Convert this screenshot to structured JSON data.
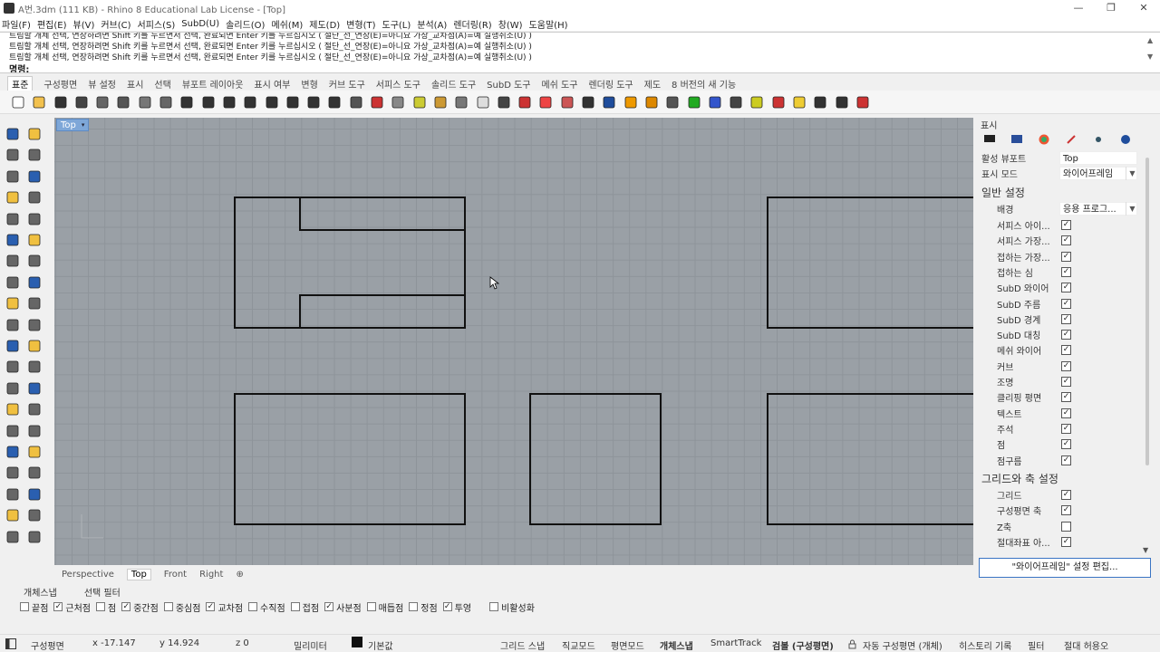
{
  "window": {
    "title": "A번.3dm (111 KB) - Rhino 8 Educational Lab License - [Top]",
    "min": "—",
    "max": "❐",
    "close": "✕"
  },
  "menu": [
    "파일(F)",
    "편집(E)",
    "뷰(V)",
    "커브(C)",
    "서피스(S)",
    "SubD(U)",
    "솔리드(O)",
    "메쉬(M)",
    "제도(D)",
    "변형(T)",
    "도구(L)",
    "분석(A)",
    "렌더링(R)",
    "창(W)",
    "도움말(H)"
  ],
  "command": {
    "lines": [
      "트림할 개체 선택, 연장하려면 Shift 키를 누르면서 선택, 완료되면 Enter 키를 누르십시오 ( 절단_선_연장(E)=아니요  가상_교차점(A)=예  실행취소(U) )",
      "트림할 개체 선택, 연장하려면 Shift 키를 누르면서 선택, 완료되면 Enter 키를 누르십시오 ( 절단_선_연장(E)=아니요  가상_교차점(A)=예  실행취소(U) )",
      "트림할 개체 선택, 연장하려면 Shift 키를 누르면서 선택, 완료되면 Enter 키를 누르십시오 ( 절단_선_연장(E)=아니요  가상_교차점(A)=예  실행취소(U) )"
    ],
    "prompt": "명령:"
  },
  "toolbar_tabs": [
    "표준",
    "구성평면",
    "뷰 설정",
    "표시",
    "선택",
    "뷰포트 레이아웃",
    "표시 여부",
    "변형",
    "커브 도구",
    "서피스 도구",
    "솔리드 도구",
    "SubD 도구",
    "메쉬 도구",
    "렌더링 도구",
    "제도",
    "8 버전의 새 기능"
  ],
  "toolbar_icons": [
    "new",
    "open",
    "save",
    "print",
    "props",
    "cut",
    "copy",
    "paste",
    "undo",
    "pan",
    "rotate",
    "zoom",
    "zoom-window",
    "zoom-extents",
    "zoom-selected",
    "undo-view",
    "four-views",
    "car",
    "shade",
    "cplane",
    "grid-snap",
    "osnap",
    "lightbulb",
    "lock",
    "layer",
    "color",
    "material",
    "render",
    "sphere",
    "curve-flag",
    "gear",
    "cage",
    "green-ball",
    "help",
    "spiral",
    "ruler",
    "tool-red",
    "box-yellow",
    "check",
    "move",
    "x-red"
  ],
  "viewport": {
    "label": "Top",
    "dropdown": "▾"
  },
  "viewport_tabs": [
    "Perspective",
    "Top",
    "Front",
    "Right",
    "⊕"
  ],
  "panel": {
    "title": "표시",
    "active_viewport_label": "활성 뷰포트",
    "active_viewport": "Top",
    "display_mode_label": "표시 모드",
    "display_mode": "와이어프레임",
    "general_section": "일반 설정",
    "background_label": "배경",
    "background": "응용 프로그...",
    "general_items": [
      {
        "label": "서피스 아이...",
        "checked": "✓"
      },
      {
        "label": "서피스 가장...",
        "checked": "✓"
      },
      {
        "label": "접하는 가장...",
        "checked": "✓"
      },
      {
        "label": "접하는 심",
        "checked": "✓"
      },
      {
        "label": "SubD 와이어",
        "checked": "✓"
      },
      {
        "label": "SubD 주름",
        "checked": "✓"
      },
      {
        "label": "SubD 경계",
        "checked": "✓"
      },
      {
        "label": "SubD 대칭",
        "checked": "✓"
      },
      {
        "label": "메쉬 와이어",
        "checked": "✓"
      },
      {
        "label": "커브",
        "checked": "✓"
      },
      {
        "label": "조명",
        "checked": "✓"
      },
      {
        "label": "클리핑 평면",
        "checked": "✓"
      },
      {
        "label": "텍스트",
        "checked": "✓"
      },
      {
        "label": "주석",
        "checked": "✓"
      },
      {
        "label": "점",
        "checked": "✓"
      },
      {
        "label": "점구름",
        "checked": "✓"
      }
    ],
    "grid_section": "그리드와 축 설정",
    "grid_items": [
      {
        "label": "그리드",
        "checked": "✓"
      },
      {
        "label": "구성평면 축",
        "checked": "✓"
      },
      {
        "label": "Z축",
        "checked": ""
      },
      {
        "label": "절대좌표 아...",
        "checked": "✓"
      }
    ],
    "edit_button": "\"와이어프레임\" 설정 편집..."
  },
  "osnap_tabs": [
    "개체스냅",
    "선택 필터"
  ],
  "osnaps": [
    {
      "label": "끝점",
      "checked": ""
    },
    {
      "label": "근처점",
      "checked": "✓"
    },
    {
      "label": "점",
      "checked": ""
    },
    {
      "label": "중간점",
      "checked": "✓"
    },
    {
      "label": "중심점",
      "checked": ""
    },
    {
      "label": "교차점",
      "checked": "✓"
    },
    {
      "label": "수직점",
      "checked": ""
    },
    {
      "label": "접점",
      "checked": ""
    },
    {
      "label": "사분점",
      "checked": "✓"
    },
    {
      "label": "매듭점",
      "checked": ""
    },
    {
      "label": "정점",
      "checked": ""
    },
    {
      "label": "투영",
      "checked": "✓"
    },
    {
      "label": "비활성화",
      "checked": ""
    }
  ],
  "status": {
    "cplane": "구성평면",
    "x": "x -17.147",
    "y": "y 14.924",
    "z": "z 0",
    "units": "밀리미터",
    "layer": "기본값",
    "grid_snap": "그리드 스냅",
    "ortho": "직교모드",
    "planar": "평면모드",
    "osnap": "개체스냅",
    "smarttrack": "SmartTrack",
    "gumball": "검볼 (구성평면)",
    "auto_cplane": "자동 구성평면 (개체)",
    "history": "히스토리 기록",
    "filter": "필터",
    "tolerance": "절대 허용오"
  }
}
